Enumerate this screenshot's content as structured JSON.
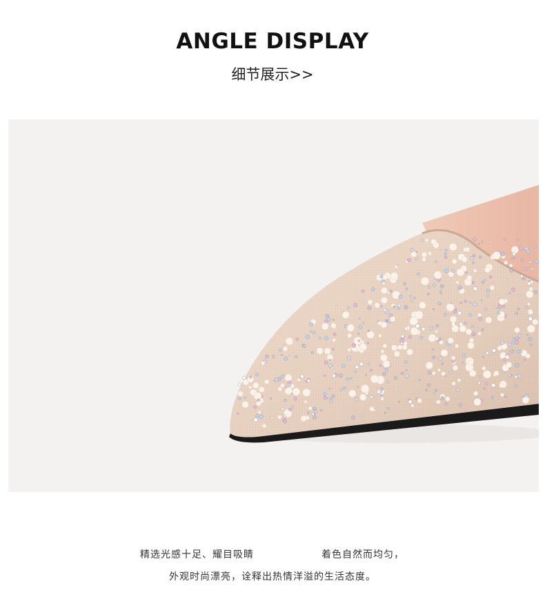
{
  "header": {
    "title": "ANGLE DISPLAY",
    "subtitle": "细节展示>>"
  },
  "photo": {
    "icon": "rhinestone-pointed-toe-shoe-image",
    "background_color": "#f3f2f1",
    "shoe_color": "#e8d3c3",
    "pearl_color": "#fbf3ea",
    "sole_color": "#1a1a1a"
  },
  "description": {
    "line1_part1": "精选光感十足、耀目吸睛",
    "line1_part2": "着色自然而均匀，",
    "line2": "外观时尚漂亮，诠释出热情洋溢的生活态度。"
  }
}
